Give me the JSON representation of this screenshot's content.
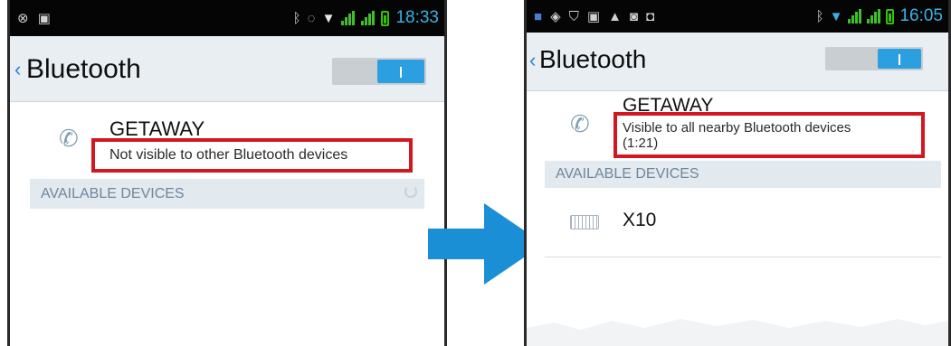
{
  "left_screen": {
    "status_time": "18:33",
    "title": "Bluetooth",
    "back_glyph": "‹",
    "device_name": "GETAWAY",
    "device_status": "Not visible to other Bluetooth devices",
    "section_header": "AVAILABLE DEVICES",
    "status_icons": [
      "android-debug-icon",
      "image-icon",
      "bluetooth-icon",
      "sync-icon",
      "wifi-icon",
      "signal-icon",
      "signal-icon",
      "battery-icon"
    ]
  },
  "right_screen": {
    "status_time": "16:05",
    "title": "Bluetooth",
    "back_glyph": "‹",
    "device_name": "GETAWAY",
    "device_status_line1": "Visible to all nearby Bluetooth devices",
    "device_status_line2": "(1:21)",
    "section_header": "AVAILABLE DEVICES",
    "available_device": "X10",
    "status_icons": [
      "app-icon",
      "gps-icon",
      "shield-icon",
      "image-icon",
      "warning-icon",
      "camera-icon",
      "briefcase-icon",
      "bluetooth-icon",
      "wifi-icon",
      "signal-icon",
      "signal-icon",
      "battery-icon"
    ]
  },
  "colors": {
    "highlight": "#d4171e",
    "arrow": "#1a8fd6",
    "accent": "#2b9fe0",
    "status_time": "#39b2e8"
  }
}
